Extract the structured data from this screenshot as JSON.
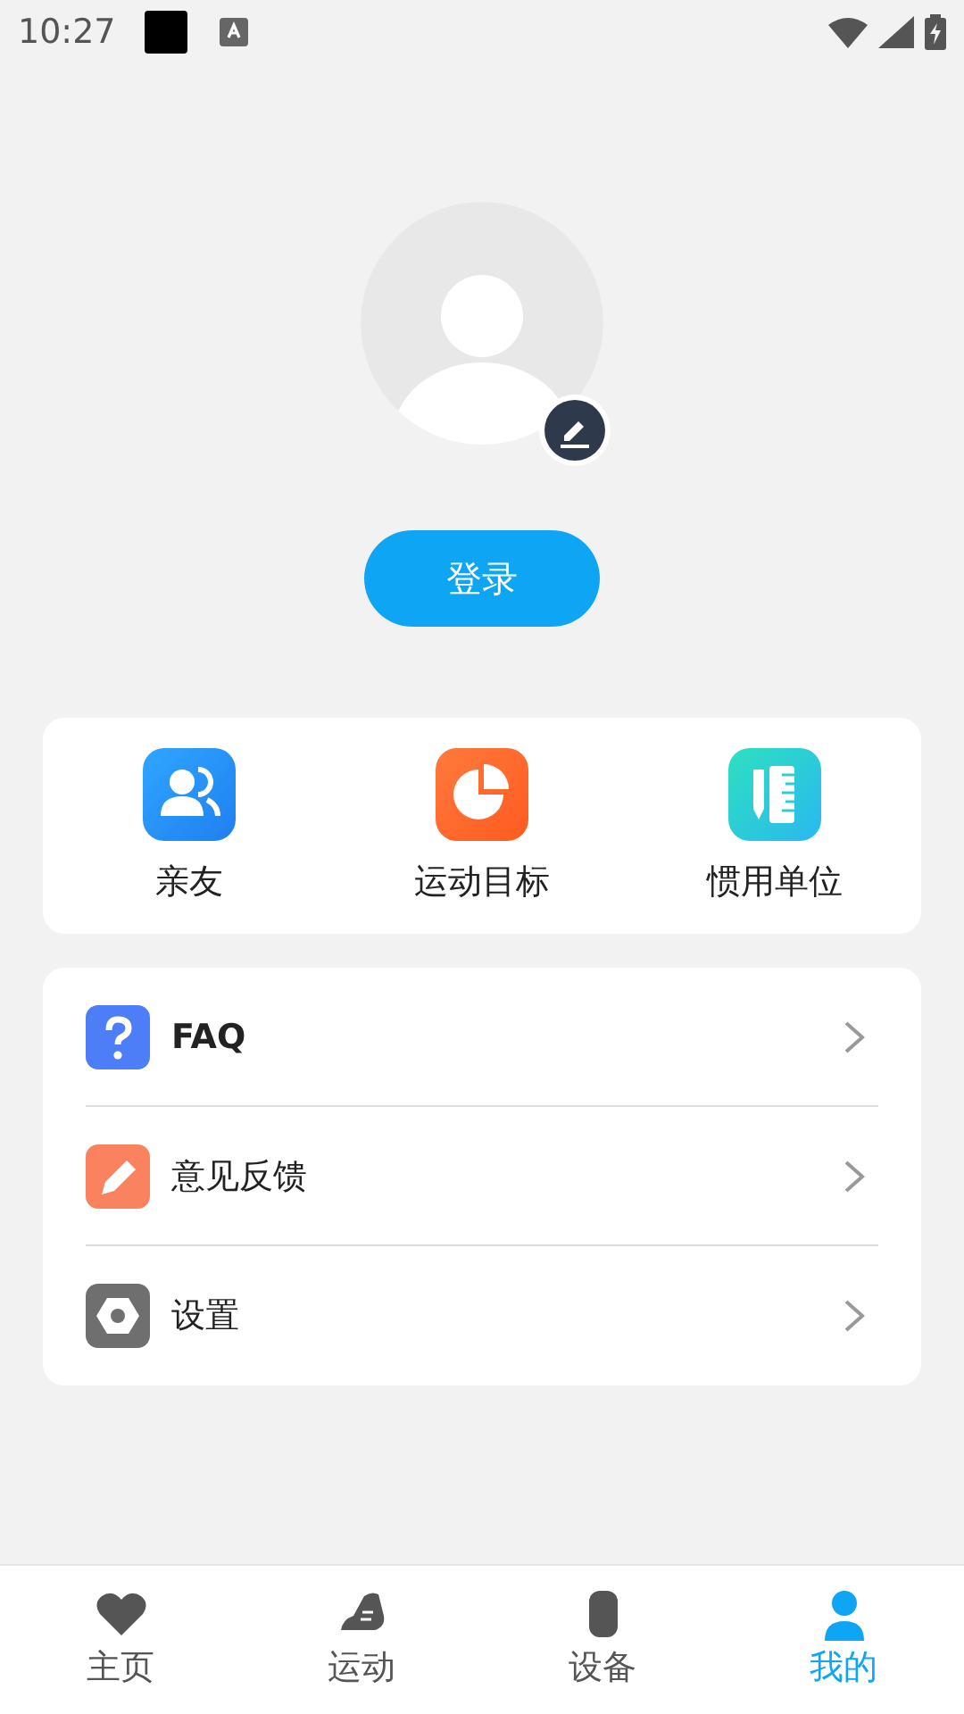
{
  "status_bar": {
    "time": "10:27"
  },
  "profile": {
    "login_button": "登录"
  },
  "shortcuts": [
    {
      "label": "亲友",
      "kind": "friends"
    },
    {
      "label": "运动目标",
      "kind": "goal"
    },
    {
      "label": "惯用单位",
      "kind": "units"
    }
  ],
  "menu": [
    {
      "label": "FAQ",
      "kind": "faq"
    },
    {
      "label": "意见反馈",
      "kind": "feedback"
    },
    {
      "label": "设置",
      "kind": "settings"
    }
  ],
  "tabs": [
    {
      "label": "主页",
      "kind": "home",
      "selected": false
    },
    {
      "label": "运动",
      "kind": "sport",
      "selected": false
    },
    {
      "label": "设备",
      "kind": "device",
      "selected": false
    },
    {
      "label": "我的",
      "kind": "me",
      "selected": true
    }
  ]
}
